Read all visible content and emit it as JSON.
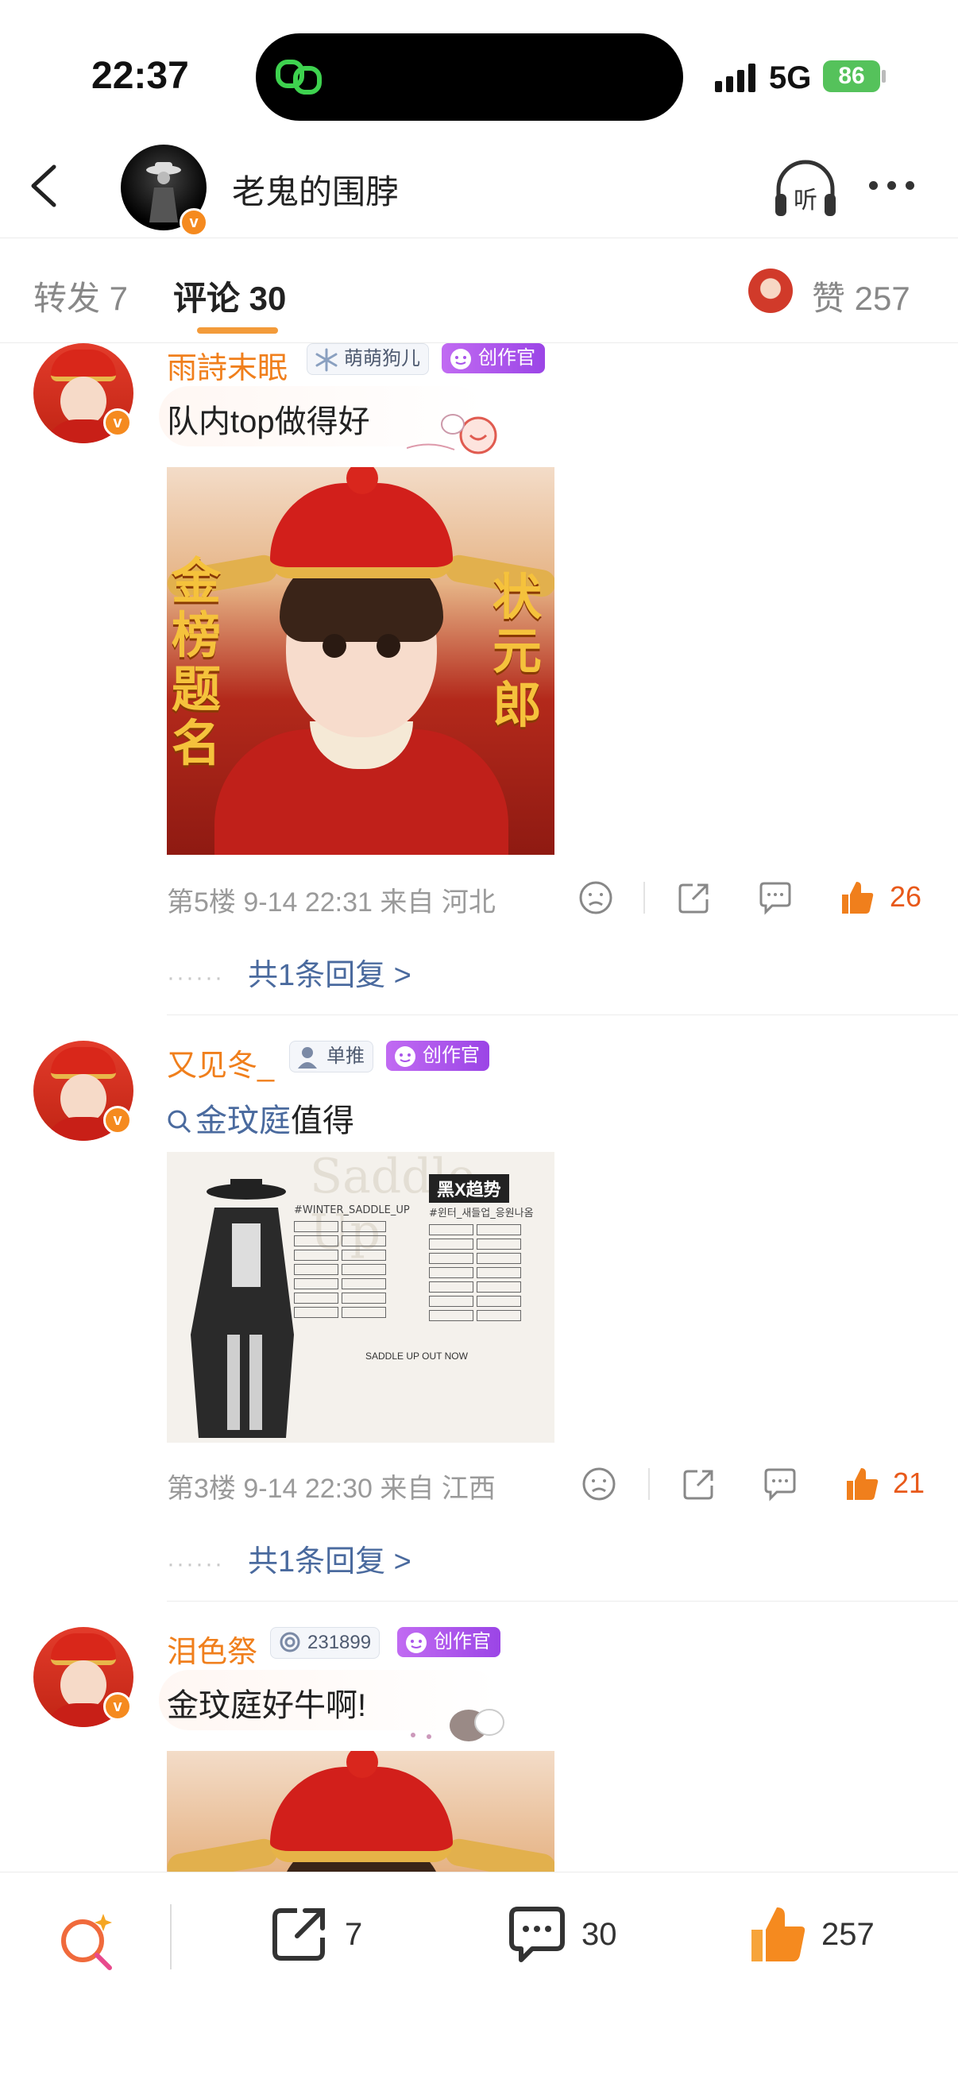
{
  "status": {
    "time": "22:37",
    "network": "5G",
    "battery": "86"
  },
  "header": {
    "title": "老鬼的围脖",
    "listen_label": "听",
    "verified_badge": "v"
  },
  "tabs": {
    "repost": "转发 7",
    "comments": "评论 30",
    "likes": "赞 257"
  },
  "comments": [
    {
      "username": "雨詩末眠",
      "fan_badge": "萌萌狗儿",
      "creator_badge": "创作官",
      "text": "队内top做得好",
      "image": {
        "left_text": "金榜题名",
        "right_text": "状元郎"
      },
      "meta": "第5楼 9-14 22:31 来自 河北",
      "likes": "26",
      "replies": "共1条回复 >"
    },
    {
      "username": "又见冬_",
      "fan_badge": "单推",
      "creator_badge": "创作官",
      "topic": "金玟庭",
      "text_after": "值得",
      "image": {
        "title": "Saddle Up",
        "tag": "黑X趋势",
        "col1_header": "#WINTER_SADDLE_UP",
        "col2_header": "#윈터_새들업_응원나옴",
        "footer": "SADDLE UP OUT NOW"
      },
      "meta": "第3楼 9-14 22:30 来自 江西",
      "likes": "21",
      "replies": "共1条回复 >"
    },
    {
      "username": "泪色祭",
      "fan_badge": "231899",
      "creator_badge": "创作官",
      "text": "金玟庭好牛啊!"
    }
  ],
  "dots": "······",
  "bottombar": {
    "reposts": "7",
    "comments": "30",
    "likes": "257"
  },
  "colors": {
    "username": "#f07f1c",
    "link": "#4a6a9e",
    "like_active": "#e8591a",
    "creator_badge": "#a955ea"
  }
}
